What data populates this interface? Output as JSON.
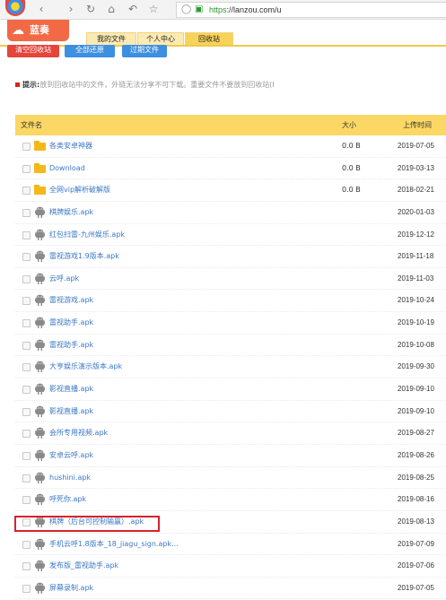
{
  "browser": {
    "url_scheme": "https",
    "url_rest": "://lanzou.com/u",
    "icons": [
      "back-icon",
      "forward-icon",
      "refresh-icon",
      "home-icon",
      "undo-icon",
      "star-icon",
      "shield-icon",
      "lock-icon"
    ]
  },
  "site": {
    "brand_name": "蓝奏",
    "brand_color": "#f26a45",
    "tabs": [
      {
        "label": "我的文件",
        "active": false
      },
      {
        "label": "个人中心",
        "active": false
      },
      {
        "label": "回收站",
        "active": true
      }
    ]
  },
  "actions": {
    "empty_label": "清空回收站",
    "restore_label": "全部还原",
    "expired_label": "过期文件"
  },
  "tip": {
    "label": "提示:",
    "text": "放到回收站中的文件，外链无法分享不可下载。重要文件不要放到回收站(I"
  },
  "table": {
    "headers": {
      "name": "文件名",
      "size": "大小",
      "date": "上传时间"
    },
    "rows": [
      {
        "type": "folder",
        "name": "各类安卓神器",
        "size": "0.0 B",
        "date": "2019-07-05"
      },
      {
        "type": "folder",
        "name": "Download",
        "size": "0.0 B",
        "date": "2019-03-13"
      },
      {
        "type": "folder",
        "name": "全网vip解析破解版",
        "size": "0.0 B",
        "date": "2018-02-21"
      },
      {
        "type": "apk",
        "name": "棋牌娱乐.apk",
        "size": "",
        "date": "2020-01-03"
      },
      {
        "type": "apk",
        "name": "红包扫雷-九州娱乐.apk",
        "size": "",
        "date": "2019-12-12"
      },
      {
        "type": "apk",
        "name": "雷视游戏1.9版本.apk",
        "size": "",
        "date": "2019-11-18"
      },
      {
        "type": "apk",
        "name": "云呼.apk",
        "size": "",
        "date": "2019-11-03"
      },
      {
        "type": "apk",
        "name": "雷视游戏.apk",
        "size": "",
        "date": "2019-10-24"
      },
      {
        "type": "apk",
        "name": "雷视助手.apk",
        "size": "",
        "date": "2019-10-19"
      },
      {
        "type": "apk",
        "name": "雷视助手.apk",
        "size": "",
        "date": "2019-10-08"
      },
      {
        "type": "apk",
        "name": "大亨娱乐演示版本.apk",
        "size": "",
        "date": "2019-09-30"
      },
      {
        "type": "apk",
        "name": "影视直播.apk",
        "size": "",
        "date": "2019-09-10"
      },
      {
        "type": "apk",
        "name": "影视直播.apk",
        "size": "",
        "date": "2019-09-10"
      },
      {
        "type": "apk",
        "name": "会所专用视频.apk",
        "size": "",
        "date": "2019-08-27"
      },
      {
        "type": "apk",
        "name": "安卓云呼.apk",
        "size": "",
        "date": "2019-08-26"
      },
      {
        "type": "apk",
        "name": "hushini.apk",
        "size": "",
        "date": "2019-08-25"
      },
      {
        "type": "apk",
        "name": "呼死你.apk",
        "size": "",
        "date": "2019-08-16"
      },
      {
        "type": "apk",
        "name": "棋牌（后台可控制输赢）.apk",
        "size": "",
        "date": "2019-08-13",
        "highlighted": true
      },
      {
        "type": "apk",
        "name": "手机云呼1.8版本_18_jiagu_sign.apk...",
        "size": "",
        "date": "2019-07-09"
      },
      {
        "type": "apk",
        "name": "发布版_雷视助手.apk",
        "size": "",
        "date": "2019-07-06"
      },
      {
        "type": "apk",
        "name": "屏幕录制.apk",
        "size": "",
        "date": "2019-07-05"
      }
    ]
  },
  "colors": {
    "header_yellow": "#fbd765",
    "link_blue": "#3a77c6",
    "highlight_red": "#d8212e"
  }
}
